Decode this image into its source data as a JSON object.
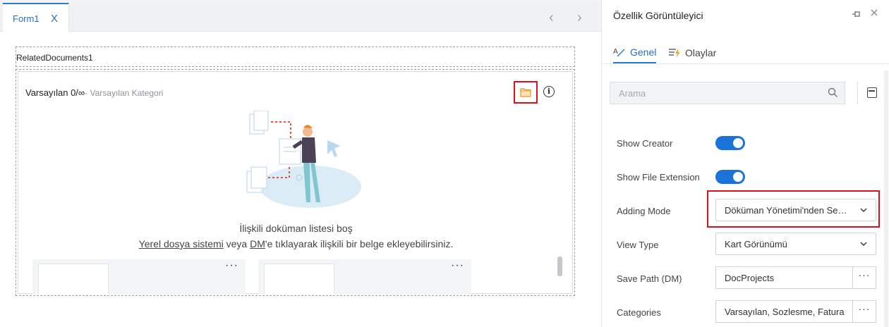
{
  "designer": {
    "tab": {
      "label": "Form1",
      "close": "X"
    },
    "nav": {
      "prev": "‹",
      "next": "›"
    },
    "component": {
      "name": "RelatedDocuments1",
      "category_title": "Varsayılan 0/∞",
      "category_sub": "- Varsayılan Kategori",
      "empty_title": "İlişkili doküman listesi boş",
      "empty_link1": "Yerel dosya sistemi",
      "empty_mid": " veya ",
      "empty_link2": "DM",
      "empty_rest": "'e tıklayarak ilişkili bir belge ekleyebilirsiniz.",
      "card_menu": "···"
    }
  },
  "panel": {
    "title": "Özellik Görüntüleyici",
    "tabs": [
      {
        "label": "Genel"
      },
      {
        "label": "Olaylar"
      }
    ],
    "search_placeholder": "Arama",
    "props": {
      "show_creator": {
        "label": "Show Creator",
        "on": true
      },
      "show_file_ext": {
        "label": "Show File Extension",
        "on": true
      },
      "adding_mode": {
        "label": "Adding Mode",
        "value": "Döküman Yönetimi'nden Seçim"
      },
      "view_type": {
        "label": "View Type",
        "value": "Kart Görünümü"
      },
      "save_path": {
        "label": "Save Path (DM)",
        "value": "DocProjects",
        "btn": "···"
      },
      "categories": {
        "label": "Categories",
        "value": "Varsayılan, Sozlesme, Fatura",
        "btn": "···"
      }
    }
  },
  "colors": {
    "accent": "#1a73d9",
    "highlight": "#e0101a",
    "folder": "#f0a53a"
  },
  "icons": [
    "close-icon",
    "chevron-left-icon",
    "chevron-right-icon",
    "folder-icon",
    "info-icon",
    "pin-icon",
    "search-icon",
    "chevron-down-icon",
    "panel-toggle-icon",
    "general-icon",
    "events-icon"
  ]
}
